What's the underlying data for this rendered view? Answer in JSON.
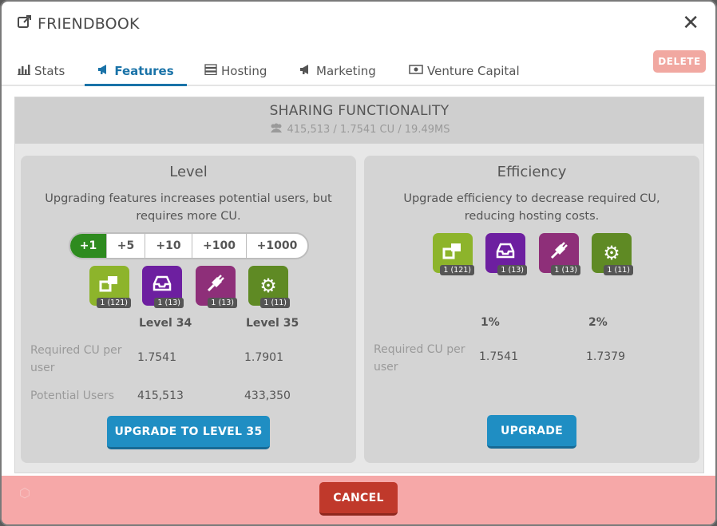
{
  "window": {
    "title": "FRIENDBOOK",
    "close_icon": "close-icon"
  },
  "tabs": [
    {
      "label": "Stats",
      "icon": "bar-chart-icon"
    },
    {
      "label": "Features",
      "icon": "megaphone-icon",
      "active": true
    },
    {
      "label": "Hosting",
      "icon": "server-icon"
    },
    {
      "label": "Marketing",
      "icon": "megaphone-icon"
    },
    {
      "label": "Venture Capital",
      "icon": "money-icon"
    }
  ],
  "delete_label": "DELETE",
  "feature": {
    "title": "SHARING FUNCTIONALITY",
    "stats": "415,513 / 1.7541 CU / 19.49MS"
  },
  "level_panel": {
    "title": "Level",
    "description": "Upgrading features increases potential users, but requires more CU.",
    "increments": [
      "+1",
      "+5",
      "+10",
      "+100",
      "+1000"
    ],
    "selected_increment": "+1",
    "requirements": [
      {
        "icon": "share-icon",
        "badge": "1 (121)",
        "color": "#8db42b"
      },
      {
        "icon": "inbox-icon",
        "badge": "1 (13)",
        "color": "#6d1fa0"
      },
      {
        "icon": "plug-icon",
        "badge": "1 (13)",
        "color": "#8e2f79"
      },
      {
        "icon": "gear-icon",
        "badge": "1 (11)",
        "color": "#5f8a24"
      }
    ],
    "col_current": "Level 34",
    "col_next": "Level 35",
    "rows": [
      {
        "label": "Required CU per user",
        "current": "1.7541",
        "next": "1.7901"
      },
      {
        "label": "Potential Users",
        "current": "415,513",
        "next": "433,350"
      }
    ],
    "button": "UPGRADE TO LEVEL 35"
  },
  "efficiency_panel": {
    "title": "Efficiency",
    "description": "Upgrade efficiency to decrease required CU, reducing hosting costs.",
    "requirements": [
      {
        "icon": "share-icon",
        "badge": "1 (121)",
        "color": "#8db42b"
      },
      {
        "icon": "inbox-icon",
        "badge": "1 (13)",
        "color": "#6d1fa0"
      },
      {
        "icon": "plug-icon",
        "badge": "1 (13)",
        "color": "#8e2f79"
      },
      {
        "icon": "gear-icon",
        "badge": "1 (11)",
        "color": "#5f8a24"
      }
    ],
    "col_current": "1%",
    "col_next": "2%",
    "rows": [
      {
        "label": "Required CU per user",
        "current": "1.7541",
        "next": "1.7379"
      }
    ],
    "button": "UPGRADE"
  },
  "footer": {
    "cancel_label": "CANCEL"
  }
}
